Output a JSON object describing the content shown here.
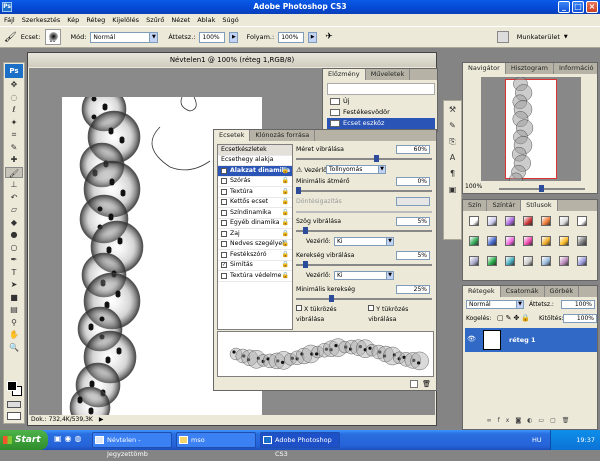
{
  "app": {
    "title": "Adobe Photoshop CS3",
    "icon": "Ps"
  },
  "menu": [
    "Fájl",
    "Szerkesztés",
    "Kép",
    "Réteg",
    "Kijelölés",
    "Szűrő",
    "Nézet",
    "Ablak",
    "Súgó"
  ],
  "options": {
    "brush_label": "Ecset:",
    "brush_size": "95",
    "mode_label": "Mód:",
    "mode_value": "Normál",
    "opacity_label": "Áttetsz.:",
    "opacity_value": "100%",
    "flow_label": "Folyam.:",
    "flow_value": "100%",
    "workspace_label": "Munkaterület"
  },
  "document": {
    "title": "Névtelen1 @ 100% (réteg 1,RGB/8)",
    "status": "Dok.: 732,4K/539,3K"
  },
  "history": {
    "tabs": [
      "Előzmény",
      "Műveletek"
    ],
    "items": [
      "Új",
      "Festékesvödör",
      "Ecset eszköz"
    ]
  },
  "brushes": {
    "tabs": [
      "Ecsetek",
      "Klónozás forrása"
    ],
    "presets_label": "Ecsetkészletek",
    "tip_label": "Ecsethegy alakja",
    "options": [
      {
        "label": "Alakzat dinamika",
        "checked": true,
        "selected": true
      },
      {
        "label": "Szórás",
        "checked": false
      },
      {
        "label": "Textúra",
        "checked": false
      },
      {
        "label": "Kettős ecset",
        "checked": false
      },
      {
        "label": "Színdinamika",
        "checked": false
      },
      {
        "label": "Egyéb dinamika",
        "checked": false
      },
      {
        "label": "Zaj",
        "checked": false
      },
      {
        "label": "Nedves szegélyek",
        "checked": false
      },
      {
        "label": "Festékszóró",
        "checked": false
      },
      {
        "label": "Simítás",
        "checked": true
      },
      {
        "label": "Textúra védelme",
        "checked": false
      }
    ],
    "size_jitter_label": "Méret vibrálása",
    "size_jitter_value": "60%",
    "size_jitter": 0.6,
    "control_label": "Vezérlő:",
    "control1_value": "Tollnyomás",
    "min_diameter_label": "Minimális átmérő",
    "min_diameter_value": "0%",
    "min_diameter": 0.0,
    "tilt_scale_label": "Döntésigazítás",
    "angle_jitter_label": "Szög vibrálása",
    "angle_jitter_value": "5%",
    "angle_jitter": 0.05,
    "control2_value": "Ki",
    "roundness_jitter_label": "Kerekség vibrálása",
    "roundness_jitter_value": "5%",
    "roundness_jitter": 0.05,
    "control3_value": "Ki",
    "min_roundness_label": "Minimális kerekség",
    "min_roundness_value": "25%",
    "min_roundness": 0.25,
    "flip_x_label": "X tükrözés vibrálása",
    "flip_y_label": "Y tükrözés vibrálása"
  },
  "navigator": {
    "tabs": [
      "Navigátor",
      "Hisztogram",
      "Információ"
    ],
    "zoom": "100%"
  },
  "color_panel": {
    "tabs": [
      "Szín",
      "Színtár",
      "Stílusok"
    ]
  },
  "layers": {
    "tabs": [
      "Rétegek",
      "Csatornák",
      "Görbék"
    ],
    "blend_mode": "Normál",
    "opacity_label": "Áttetsz.:",
    "opacity_value": "100%",
    "lock_label": "Kogelés:",
    "fill_label": "Kitöltés:",
    "fill_value": "100%",
    "layer_name": "réteg 1"
  },
  "taskbar": {
    "start": "Start",
    "tasks": [
      "Névtelen - Jegyzettömb",
      "mso",
      "Adobe Photoshop CS3"
    ],
    "lang": "HU",
    "time": "19:37"
  }
}
